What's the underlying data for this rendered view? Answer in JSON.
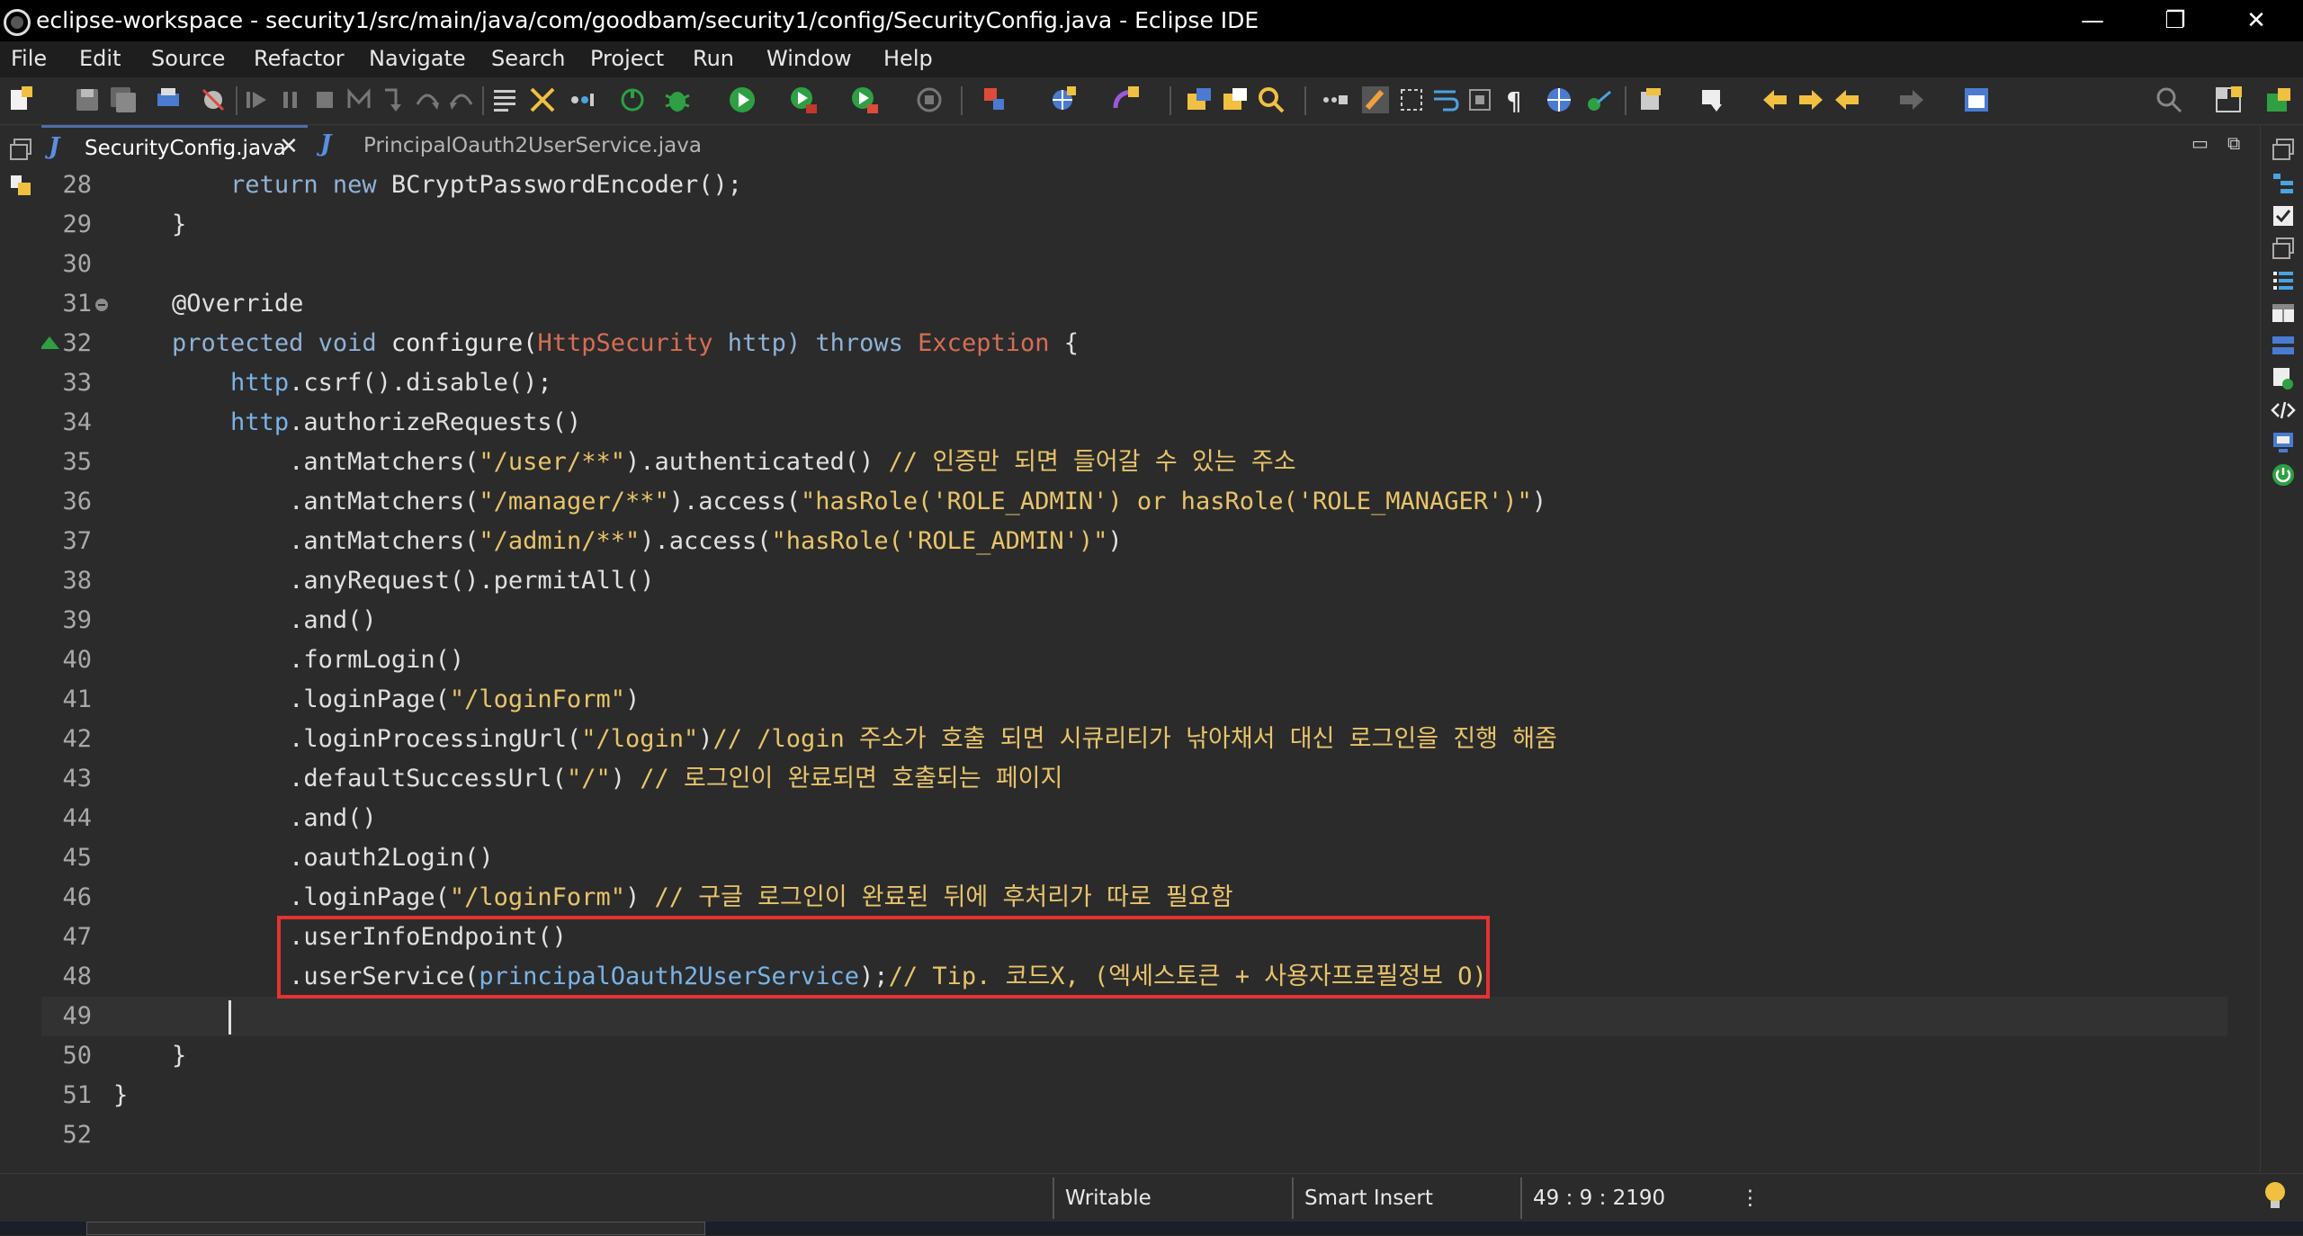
{
  "window": {
    "title": "eclipse-workspace - security1/src/main/java/com/goodbam/security1/config/SecurityConfig.java - Eclipse IDE",
    "minimize": "—",
    "maximize": "❐",
    "close": "✕"
  },
  "menu": [
    "File",
    "Edit",
    "Source",
    "Refactor",
    "Navigate",
    "Search",
    "Project",
    "Run",
    "Window",
    "Help"
  ],
  "tabs": [
    {
      "label": "SecurityConfig.java",
      "active": true,
      "close": "✕"
    },
    {
      "label": "PrincipalOauth2UserService.java",
      "active": false
    }
  ],
  "view_controls": {
    "minimize": "▭",
    "maximize": "⧉"
  },
  "editor": {
    "line_numbers": [
      "28",
      "29",
      "30",
      "31",
      "32",
      "33",
      "34",
      "35",
      "36",
      "37",
      "38",
      "39",
      "40",
      "41",
      "42",
      "43",
      "44",
      "45",
      "46",
      "47",
      "48",
      "49",
      "50",
      "51",
      "52"
    ],
    "current_line": "49",
    "highlighted_lines": [
      "47",
      "48"
    ]
  },
  "code": {
    "l28": {
      "k1": "return",
      "s1": " ",
      "k2": "new",
      "rest": " BCryptPasswordEncoder();"
    },
    "l29": {
      "text": "}"
    },
    "l31": {
      "ann": "@Override"
    },
    "l32": {
      "k1": "protected",
      "k2": "void",
      "name": "configure(",
      "type": "HttpSecurity",
      "param": " http)",
      "throws": "throws",
      "exc": "Exception",
      "brace": " {"
    },
    "l33": {
      "fld": "http",
      "rest": ".csrf().disable();"
    },
    "l34": {
      "fld": "http",
      "rest": ".authorizeRequests()"
    },
    "l35": {
      "pre": ".antMatchers(",
      "str": "\"/user/**\"",
      "post": ").authenticated() ",
      "cm": "// 인증만 되면 들어갈 수 있는 주소"
    },
    "l36": {
      "pre": ".antMatchers(",
      "str": "\"/manager/**\"",
      "mid": ").access(",
      "str2": "\"hasRole('ROLE_ADMIN') or hasRole('ROLE_MANAGER')\"",
      "post": ")"
    },
    "l37": {
      "pre": ".antMatchers(",
      "str": "\"/admin/**\"",
      "mid": ").access(",
      "str2": "\"hasRole('ROLE_ADMIN')\"",
      "post": ")"
    },
    "l38": {
      "text": ".anyRequest().permitAll()"
    },
    "l39": {
      "text": ".and()"
    },
    "l40": {
      "text": ".formLogin()"
    },
    "l41": {
      "pre": ".loginPage(",
      "str": "\"/loginForm\"",
      "post": ")"
    },
    "l42": {
      "pre": ".loginProcessingUrl(",
      "str": "\"/login\"",
      "post": ")",
      "cm": "// /login 주소가 호출 되면 시큐리티가 낚아채서 대신 로그인을 진행 해줌"
    },
    "l43": {
      "pre": ".defaultSuccessUrl(",
      "str": "\"/\"",
      "post": ") ",
      "cm": "// 로그인이 완료되면 호출되는 페이지"
    },
    "l44": {
      "text": ".and()"
    },
    "l45": {
      "text": ".oauth2Login()"
    },
    "l46": {
      "pre": ".loginPage(",
      "str": "\"/loginForm\"",
      "post": ") ",
      "cm": "// 구글 로그인이 완료된 뒤에 후처리가 따로 필요함"
    },
    "l47": {
      "text": ".userInfoEndpoint()"
    },
    "l48": {
      "pre": ".userService(",
      "fld": "principalOauth2UserService",
      "post": ");",
      "cm": "// Tip. 코드X, (엑세스토큰 + 사용자프로필정보 O)"
    },
    "l50": {
      "text": "}"
    },
    "l51": {
      "text": "}"
    }
  },
  "status": {
    "writable": "Writable",
    "insert_mode": "Smart Insert",
    "position": "49 : 9 : 2190",
    "menu": "⋮"
  },
  "colors": {
    "keyword": "#cc7832",
    "keyword_blue": "#8fb2d6",
    "string": "#e8c46a",
    "type": "#d56e55",
    "field": "#7ab3e6",
    "highlight_box": "#e53232"
  },
  "icons": {
    "toolbar": [
      "new-icon",
      "save-icon",
      "save-all-icon",
      "print-icon",
      "skip-breakpoints-icon",
      "resume-icon",
      "suspend-icon",
      "terminate-icon",
      "disconnect-icon",
      "step-into-icon",
      "step-over-icon",
      "step-return-icon",
      "drop-to-frame-icon",
      "use-step-filters-icon",
      "open-console-icon",
      "debug-icon",
      "run-icon",
      "coverage-icon",
      "external-tools-icon",
      "stop-icon",
      "new-java-package-icon",
      "new-java-class-icon",
      "open-type-icon",
      "open-task-icon",
      "search-icon",
      "mark-occurrences-icon",
      "toggle-highlight-icon",
      "block-selection-icon",
      "word-wrap-icon",
      "show-whitespace-icon",
      "show-paragraph-icon",
      "browser-icon",
      "spring-icon",
      "annotation-icon",
      "last-edit-icon",
      "next-annotation-icon",
      "previous-annotation-icon",
      "back-icon",
      "forward-icon",
      "pin-editor-icon",
      "quick-access-search-icon",
      "perspective-open-icon",
      "perspective-java-icon"
    ]
  }
}
